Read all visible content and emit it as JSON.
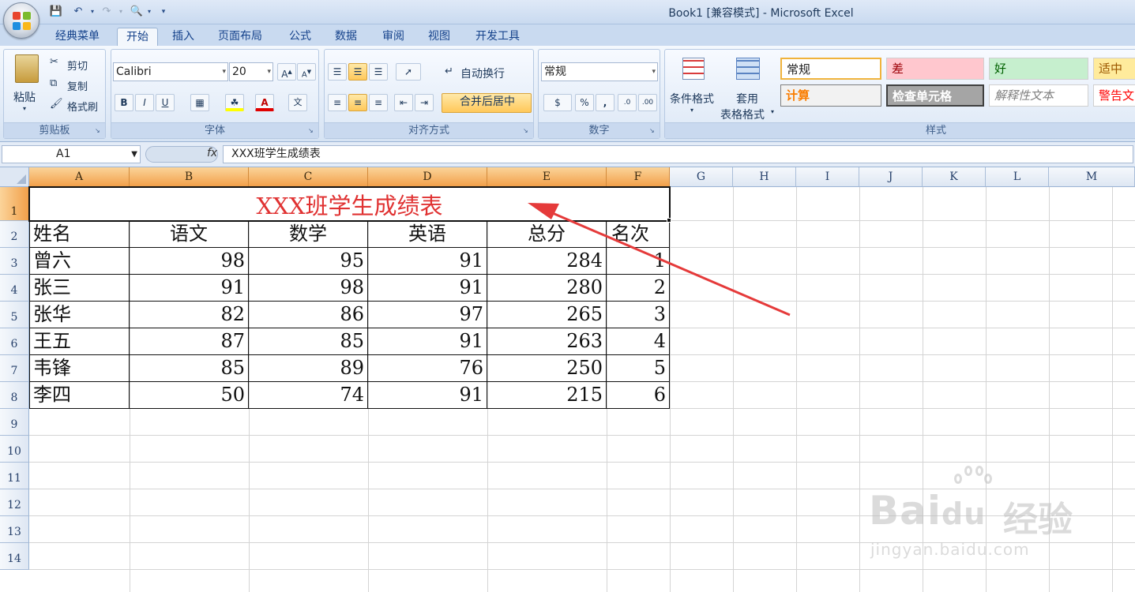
{
  "window": {
    "title": "Book1  [兼容模式] - Microsoft Excel"
  },
  "tabs": [
    "经典菜单",
    "开始",
    "插入",
    "页面布局",
    "公式",
    "数据",
    "审阅",
    "视图",
    "开发工具"
  ],
  "active_tab": "开始",
  "ribbon": {
    "clipboard": {
      "label": "剪贴板",
      "paste": "粘贴",
      "cut": "剪切",
      "copy": "复制",
      "format_painter": "格式刷"
    },
    "font": {
      "label": "字体",
      "font_name": "Calibri",
      "font_size": "20"
    },
    "alignment": {
      "label": "对齐方式",
      "wrap_text": "自动换行",
      "merge_center": "合并后居中"
    },
    "number": {
      "label": "数字",
      "format": "常规"
    },
    "styles": {
      "label": "样式",
      "conditional_format": "条件格式",
      "table_format_1": "套用",
      "table_format_2": "表格格式",
      "cells": [
        {
          "text": "常规",
          "bg": "#ffffff",
          "fg": "#111111"
        },
        {
          "text": "差",
          "bg": "#ffc7ce",
          "fg": "#9c0006"
        },
        {
          "text": "好",
          "bg": "#c6efce",
          "fg": "#006100"
        },
        {
          "text": "适中",
          "bg": "#ffeb9c",
          "fg": "#9c5700"
        },
        {
          "text": "计算",
          "bg": "#f2f2f2",
          "fg": "#fa7d00"
        },
        {
          "text": "检查单元格",
          "bg": "#a5a5a5",
          "fg": "#ffffff"
        },
        {
          "text": "解释性文本",
          "bg": "#ffffff",
          "fg": "#7f7f7f"
        },
        {
          "text": "警告文",
          "bg": "#ffffff",
          "fg": "#ff0000"
        }
      ]
    }
  },
  "formula_bar": {
    "name_box": "A1",
    "fx": "fx",
    "content": "XXX班学生成绩表"
  },
  "sheet": {
    "columns": [
      "A",
      "B",
      "C",
      "D",
      "E",
      "F",
      "G",
      "H",
      "I",
      "J",
      "K",
      "L",
      "M"
    ],
    "rows": [
      "1",
      "2",
      "3",
      "4",
      "5",
      "6",
      "7",
      "8",
      "9",
      "10",
      "11",
      "12",
      "13",
      "14"
    ],
    "title": "XXX班学生成绩表",
    "headers": [
      "姓名",
      "语文",
      "数学",
      "英语",
      "总分",
      "名次"
    ],
    "data": [
      [
        "曾六",
        "98",
        "95",
        "91",
        "284",
        "1"
      ],
      [
        "张三",
        "91",
        "98",
        "91",
        "280",
        "2"
      ],
      [
        "张华",
        "82",
        "86",
        "97",
        "265",
        "3"
      ],
      [
        "王五",
        "87",
        "85",
        "91",
        "263",
        "4"
      ],
      [
        "韦锋",
        "85",
        "89",
        "76",
        "250",
        "5"
      ],
      [
        "李四",
        "50",
        "74",
        "91",
        "215",
        "6"
      ]
    ]
  },
  "watermark": {
    "brand": "Bai",
    "brand2": "du",
    "brand_cn": "经验",
    "url": "jingyan.baidu.com"
  },
  "colors": {
    "title_red": "#e03232",
    "arrow_red": "#e53a3a",
    "selected_header": "#f2a04a"
  }
}
